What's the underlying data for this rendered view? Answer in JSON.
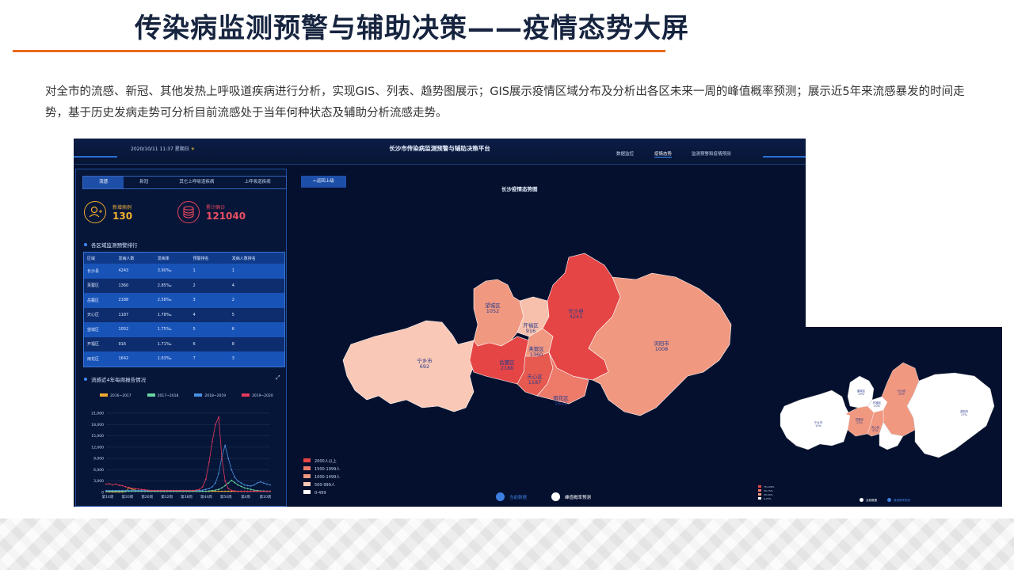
{
  "slide": {
    "title": "传染病监测预警与辅助决策——疫情态势大屏",
    "description": "对全市的流感、新冠、其他发热上呼吸道疾病进行分析，实现GIS、列表、趋势图展示；GIS展示疫情区域分布及分析出各区未来一周的峰值概率预测；展示近5年来流感暴发的时间走势，基于历史发病走势可分析目前流感处于当年何种状态及辅助分析流感走势。"
  },
  "dashboard": {
    "datetime": "2020/10/11  11:37  星期日",
    "platform_title": "长沙市传染病监测预警与辅助决策平台",
    "nav": [
      "数据监控",
      "疫情态势",
      "监测预警和疫情预测"
    ],
    "nav_active_index": 1,
    "tabs": [
      "流感",
      "新冠",
      "其它上呼吸道疾病",
      "上呼吸道疾病"
    ],
    "active_tab_index": 0,
    "stats": {
      "new_cases_label": "新增病例",
      "new_cases_value": "130",
      "total_label": "累计确诊",
      "total_value": "121040"
    },
    "ranking": {
      "title": "各区域监测预警排行",
      "columns": [
        "区域",
        "发病人数",
        "发病率",
        "预警排名",
        "发病人数排名"
      ],
      "rows": [
        [
          "长沙县",
          "4243",
          "3.90‰",
          "1",
          "1"
        ],
        [
          "芙蓉区",
          "1360",
          "2.85‰",
          "2",
          "4"
        ],
        [
          "岳麓区",
          "2188",
          "2.58‰",
          "3",
          "2"
        ],
        [
          "天心区",
          "1187",
          "1.78‰",
          "4",
          "5"
        ],
        [
          "望城区",
          "1052",
          "1.75‰",
          "5",
          "6"
        ],
        [
          "开福区",
          "916",
          "1.71‰",
          "6",
          "8"
        ],
        [
          "雨花区",
          "1642",
          "1.63‰",
          "7",
          "3"
        ]
      ]
    },
    "trend_title": "流感近4年每周报告情况",
    "back_button": "←返回上级",
    "map": {
      "title": "长沙疫情态势图",
      "regions": [
        {
          "name": "望城区",
          "value": "1052",
          "color": "#f19880"
        },
        {
          "name": "开福区",
          "value": "916",
          "color": "#f7c0ad"
        },
        {
          "name": "长沙县",
          "value": "4243",
          "color": "#e54545"
        },
        {
          "name": "浏阳市",
          "value": "1008",
          "color": "#f19880"
        },
        {
          "name": "宁乡市",
          "value": "692",
          "color": "#f9c8b6"
        },
        {
          "name": "岳麓区",
          "value": "2188",
          "color": "#e54545"
        },
        {
          "name": "芙蓉区",
          "value": "1360",
          "color": "#f19880"
        },
        {
          "name": "天心区",
          "value": "1187",
          "color": "#e65a50"
        },
        {
          "name": "雨花区",
          "value": "1642",
          "color": "#ee7a6a"
        }
      ],
      "legend": [
        {
          "label": "2000人以上",
          "color": "#e54545"
        },
        {
          "label": "1500-1999人",
          "color": "#ee7a6a"
        },
        {
          "label": "1000-1499人",
          "color": "#f19880"
        },
        {
          "label": "500-999人",
          "color": "#f9c8b6"
        },
        {
          "label": "0-499",
          "color": "#ffffff"
        }
      ],
      "switch": {
        "current_label": "当前数据",
        "predict_label": "峰值概率预测",
        "current_color": "#3d7fe0",
        "predict_color": "#ffffff"
      }
    },
    "overlay_map": {
      "regions": [
        {
          "name": "望城区",
          "value": "19%"
        },
        {
          "name": "开福区",
          "value": "20%"
        },
        {
          "name": "长沙县",
          "value": "29%"
        },
        {
          "name": "浏阳市",
          "value": "27%"
        },
        {
          "name": "宁乡市",
          "value": "15%"
        },
        {
          "name": "岳麓区",
          "value": "22%"
        },
        {
          "name": "天心区",
          "value": "23%"
        }
      ],
      "legend": [
        "75-100%",
        "50-74%",
        "25-50%",
        "0-25%"
      ],
      "switch": {
        "current_label": "当前数据",
        "predict_label": "峰值概率预测"
      }
    }
  },
  "chart_data": {
    "type": "line",
    "title": "流感近4年每周报告情况",
    "categories": [
      "第14周",
      "第20周",
      "第26周",
      "第32周",
      "第38周",
      "第44周",
      "第50周",
      "第4周",
      "第10周"
    ],
    "ylim": [
      0,
      21000
    ],
    "yticks": [
      0,
      3000,
      6000,
      9000,
      12000,
      15000,
      18000,
      21000
    ],
    "ytick_labels": [
      "0",
      "3,000",
      "6,000",
      "9,000",
      "12,000",
      "15,000",
      "18,000",
      "21,000"
    ],
    "grid": true,
    "legend_position": "top",
    "series": [
      {
        "name": "2016~2017",
        "color": "#f0a830",
        "values": [
          200,
          150,
          100,
          100,
          100,
          100,
          200,
          1200,
          900,
          600,
          400,
          300,
          300,
          300,
          300,
          300,
          300,
          300,
          300,
          300,
          300,
          300,
          300,
          300,
          300,
          300,
          300,
          300,
          300,
          300,
          300,
          300,
          300,
          300,
          300,
          300,
          300,
          300,
          300,
          300,
          300,
          300,
          300,
          300,
          300,
          300,
          300,
          300,
          300,
          300,
          300,
          300
        ]
      },
      {
        "name": "2017~2018",
        "color": "#6ad4a0",
        "values": [
          300,
          300,
          300,
          300,
          300,
          300,
          300,
          300,
          300,
          300,
          300,
          300,
          300,
          300,
          300,
          300,
          300,
          300,
          300,
          300,
          300,
          300,
          300,
          300,
          300,
          300,
          300,
          300,
          300,
          300,
          300,
          300,
          400,
          500,
          600,
          800,
          1200,
          1800,
          2500,
          3200,
          2600,
          2000,
          1600,
          1200,
          1000,
          800,
          600,
          500,
          400,
          400,
          300,
          300
        ]
      },
      {
        "name": "2018~2019",
        "color": "#4a8fe0",
        "values": [
          500,
          500,
          500,
          500,
          500,
          500,
          500,
          500,
          500,
          500,
          500,
          500,
          500,
          500,
          500,
          500,
          500,
          500,
          500,
          500,
          500,
          500,
          500,
          500,
          500,
          500,
          500,
          500,
          500,
          500,
          600,
          800,
          1000,
          1500,
          2500,
          5000,
          9500,
          12500,
          9000,
          6000,
          4000,
          3000,
          2500,
          2000,
          1800,
          1700,
          2000,
          2500,
          2800,
          2500,
          2200,
          2000
        ]
      },
      {
        "name": "2019~2020",
        "color": "#e53a5c",
        "values": [
          2200,
          2300,
          2000,
          2200,
          1900,
          1800,
          1500,
          1300,
          1100,
          1000,
          900,
          800,
          700,
          600,
          500,
          500,
          500,
          500,
          500,
          500,
          500,
          500,
          500,
          500,
          500,
          500,
          500,
          500,
          600,
          800,
          1500,
          3500,
          8000,
          13500,
          18000,
          20000,
          9000,
          3000,
          1000,
          500,
          400,
          300,
          300,
          300,
          300,
          300,
          300,
          300,
          300,
          300,
          300,
          300
        ]
      }
    ]
  }
}
